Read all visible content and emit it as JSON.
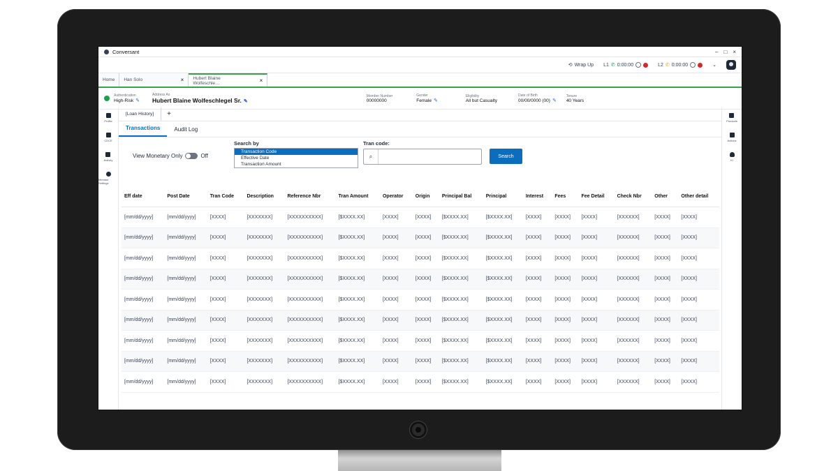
{
  "app": {
    "title": "Conversant",
    "window_controls": [
      "–",
      "□",
      "×"
    ]
  },
  "callbar": {
    "wrap_up": "Wrap Up",
    "l1_label": "L1",
    "l1_timer": "0:00:00",
    "l2_label": "L2",
    "l2_timer": "0:00:00"
  },
  "tabs": {
    "home": "Home",
    "t1": "Han Solo",
    "t2": "Hubert Blaine Wolfeschle…",
    "close": "×"
  },
  "member": {
    "auth_label": "Authentication",
    "auth_value": "High-Risk",
    "addr_label": "Address As",
    "addr_value": "Hubert Blaine Wolfeschlegel Sr.",
    "num_label": "Member Number",
    "num_value": "00000000",
    "gender_label": "Gender",
    "gender_value": "Female",
    "elig_label": "Eligibility",
    "elig_value": "All but Casualty",
    "dob_label": "Date of Birth",
    "dob_value": "00/00/0000 (00)",
    "tenure_label": "Tenure",
    "tenure_value": "40 Years"
  },
  "left_rail": [
    "Profile",
    "CDCE",
    "Activity",
    "Member Settings"
  ],
  "right_rail": [
    "Products",
    "Actions",
    "KI"
  ],
  "subtab": {
    "label": "[Loan History]",
    "add": "+"
  },
  "inner_tabs": {
    "transactions": "Transactions",
    "audit": "Audit Log"
  },
  "search": {
    "toggle_label": "View Monetary Only",
    "toggle_state": "Off",
    "search_by_label": "Search by",
    "options": [
      "Transaction Code",
      "Effective Date",
      "Transaction Amount"
    ],
    "selected_option": "Transaction Code",
    "tran_code_label": "Tran code:",
    "tran_code_value": "",
    "button": "Search"
  },
  "table": {
    "headers": [
      "Eff date",
      "Post Date",
      "Tran Code",
      "Description",
      "Reference Nbr",
      "Tran Amount",
      "Operator",
      "Origin",
      "Principal Bal",
      "Principal",
      "Interest",
      "Fees",
      "Fee Detail",
      "Check Nbr",
      "Other",
      "Other detail"
    ],
    "row": [
      "[mm/dd/yyyy]",
      "[mm/dd/yyyy]",
      "[XXXX]",
      "[XXXXXXX]",
      "[XXXXXXXXXX]",
      "[$XXXX.XX]",
      "[XXXX]",
      "[XXXX]",
      "[$XXXX.XX]",
      "[$XXXX.XX]",
      "[XXXX]",
      "[XXXX]",
      "[XXXX]",
      "[XXXXXX]",
      "[XXXX]",
      "[XXXX]"
    ],
    "row_count": 9
  },
  "colors": {
    "accent": "#0b6dbd",
    "tab_green": "#3aa14a"
  }
}
